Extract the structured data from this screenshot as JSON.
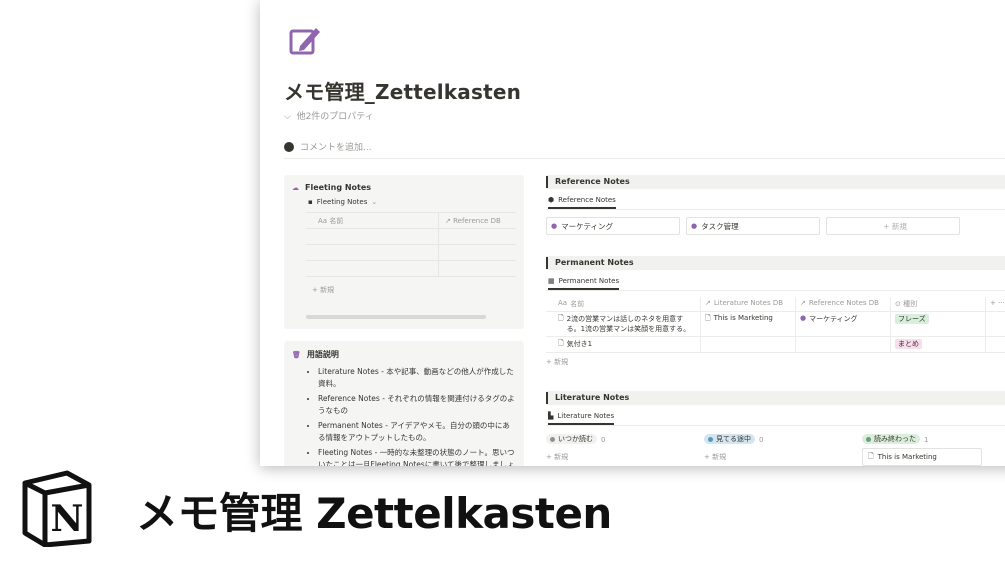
{
  "page": {
    "title": "メモ管理_Zettelkasten",
    "properties_toggle": "他2件のプロパティ",
    "comment_placeholder": "コメントを追加..."
  },
  "fleeting": {
    "title": "Fleeting Notes",
    "view_label": "Fleeting Notes",
    "col_name": "名前",
    "col_name_prefix": "Aa",
    "col_ref": "Reference DB",
    "new_label": "+ 新規"
  },
  "glossary": {
    "title": "用語説明",
    "items": [
      "Literature Notes - 本や記事、動画などの他人が作成した資料。",
      "Reference Notes - それぞれの情報を関連付けるタグのようなもの",
      "Permanent Notes - アイデアやメモ。自分の頭の中にある情報をアウトプットしたもの。",
      "Fleeting Notes - 一時的な未整理の状態のノート。思いついたことは一旦Fleeting Notesに書いて後で整理しましょう。"
    ]
  },
  "reference": {
    "section_title": "Reference Notes",
    "view_label": "Reference Notes",
    "cards": [
      "マーケティング",
      "タスク管理"
    ],
    "new_label": "+ 新規"
  },
  "permanent": {
    "section_title": "Permanent Notes",
    "view_label": "Permanent Notes",
    "col_name": "名前",
    "col_name_prefix": "Aa",
    "col_lit": "Literature Notes DB",
    "col_ref": "Reference Notes DB",
    "col_type": "種別",
    "col_more": "+ ···",
    "rows": [
      {
        "name": "2流の営業マンは話しのネタを用意する。1流の営業マンは笑顔を用意する。",
        "lit": "This is Marketing",
        "ref": "マーケティング",
        "type": "フレーズ",
        "type_color": "#dbeddb",
        "type_text": "#1c3829"
      },
      {
        "name": "気付き1",
        "lit": "",
        "ref": "",
        "type": "まとめ",
        "type_color": "#f4dfeb",
        "type_text": "#4c2337"
      }
    ],
    "new_label": "+ 新規"
  },
  "literature": {
    "section_title": "Literature Notes",
    "view_label": "Literature Notes",
    "columns": [
      {
        "label": "いつか読む",
        "count": "0",
        "bg": "#f1f1ef",
        "dot": "#91918e"
      },
      {
        "label": "見てる途中",
        "count": "0",
        "bg": "#d3e5ef",
        "dot": "#5b97bd"
      },
      {
        "label": "読み終わった",
        "count": "1",
        "bg": "#dbeddb",
        "dot": "#6c9b7d"
      }
    ],
    "new_label": "+ 新規",
    "card": "This is Marketing"
  },
  "banner": {
    "title": "メモ管理 Zettelkasten",
    "logo_letter": "N"
  },
  "colors": {
    "accent_purple": "#9065b0",
    "text": "#37352f",
    "muted": "#9b9a97"
  }
}
